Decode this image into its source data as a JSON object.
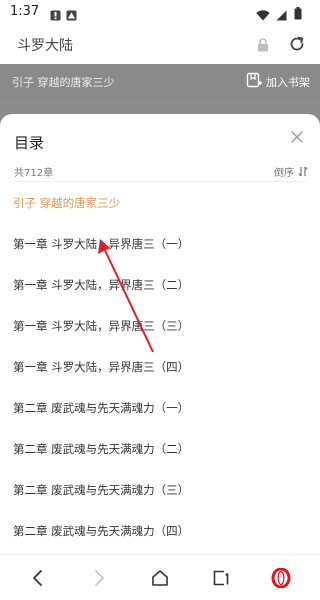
{
  "status_bar": {
    "time": "1:37",
    "icons": [
      "notification-icon",
      "album-icon",
      "wifi-icon",
      "cell-signal-icon",
      "battery-icon"
    ]
  },
  "address_bar": {
    "title": "斗罗大陆",
    "icons": [
      "lock-icon",
      "reload-icon"
    ]
  },
  "page": {
    "chapter_name": "引子 穿越的唐家三少",
    "bookmark_label": "加入书架",
    "big_title": "引子 穿越的唐家三少"
  },
  "catalog": {
    "title": "目录",
    "count": "共712章",
    "sort_label": "倒序",
    "chapters": [
      "引子 穿越的唐家三少",
      "第一章 斗罗大陆，异界唐三（一）",
      "第一章 斗罗大陆，异界唐三（二）",
      "第一章 斗罗大陆，异界唐三（三）",
      "第一章 斗罗大陆，异界唐三（四）",
      "第二章 废武魂与先天满魂力（一）",
      "第二章 废武魂与先天满魂力（二）",
      "第二章 废武魂与先天满魂力（三）",
      "第二章 废武魂与先天满魂力（四）"
    ]
  },
  "colors": {
    "accent": "#e8944a",
    "annotation": "#d9222a",
    "opera_red": "#e3141b"
  }
}
